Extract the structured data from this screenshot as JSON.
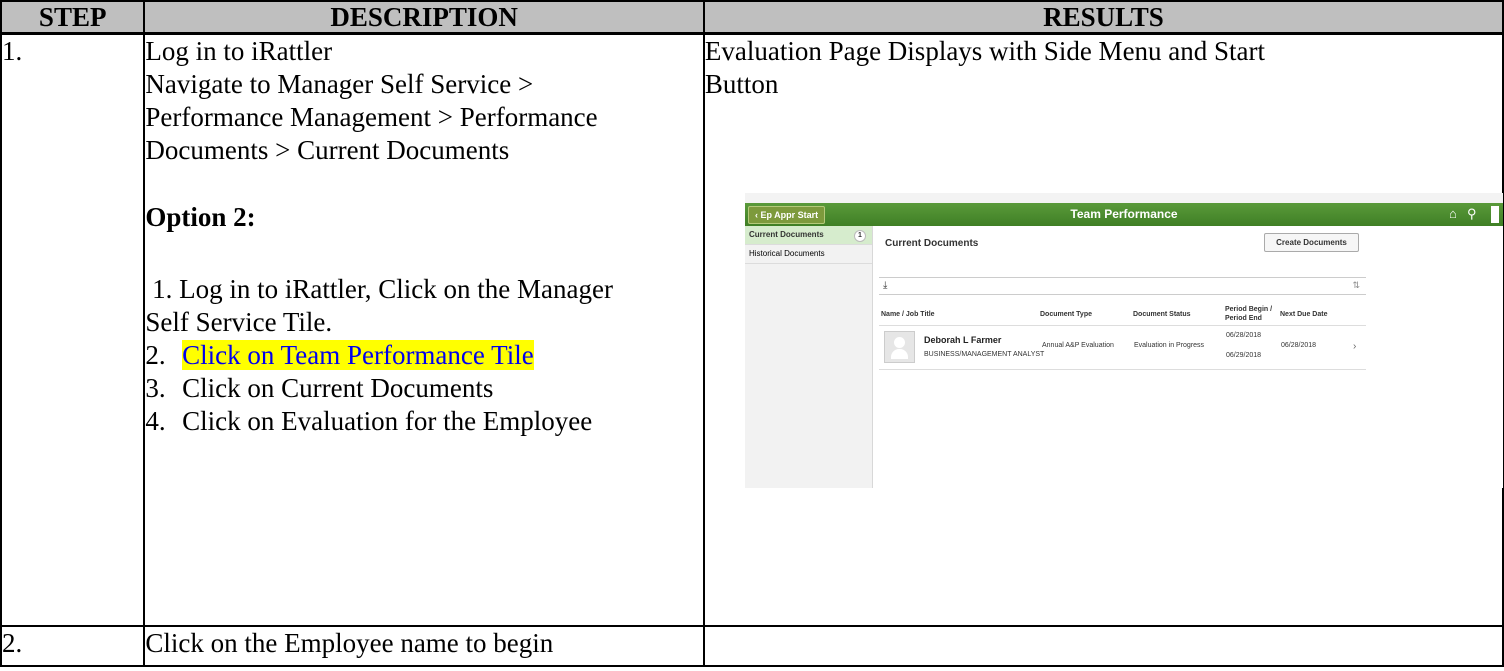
{
  "headers": {
    "step": "STEP",
    "description": "DESCRIPTION",
    "results": "RESULTS"
  },
  "row1": {
    "step": "1.",
    "desc_lines": [
      "Log in to iRattler",
      "Navigate to Manager Self Service >",
      "Performance Management > Performance",
      "Documents > Current Documents"
    ],
    "option_heading": "Option 2:",
    "option_steps": [
      {
        "num": "1.",
        "text": "Log in to iRattler, Click on the Manager",
        "cont": "Self Service Tile."
      },
      {
        "num": "2.",
        "text": "Click on Team Performance Tile"
      },
      {
        "num": "3.",
        "text": "Click on Current Documents"
      },
      {
        "num": "4.",
        "text": "Click on Evaluation for the Employee"
      }
    ],
    "result_text_line1": "Evaluation Page Displays with Side Menu and Start",
    "result_text_line2": "Button"
  },
  "row2": {
    "step": "2.",
    "desc": "Click on the Employee name to begin"
  },
  "screenshot": {
    "back_button": "Ep Appr Start",
    "banner_title": "Team Performance",
    "side_menu": [
      {
        "label": "Current Documents",
        "badge": "1"
      },
      {
        "label": "Historical Documents"
      }
    ],
    "page_heading": "Current Documents",
    "create_button": "Create Documents",
    "columns": [
      "Name / Job Title",
      "Document Type",
      "Document Status",
      "Period Begin /",
      "Period End",
      "Next Due Date"
    ],
    "row": {
      "name": "Deborah L Farmer",
      "job_title": "BUSINESS/MANAGEMENT ANALYST",
      "doc_type": "Annual A&P Evaluation",
      "status": "Evaluation in Progress",
      "period_begin": "06/28/2018",
      "period_end": "06/29/2018",
      "next_due": "06/28/2018"
    },
    "colors": {
      "banner": "#4a8c2e",
      "active_menu": "#d6eccd"
    }
  }
}
